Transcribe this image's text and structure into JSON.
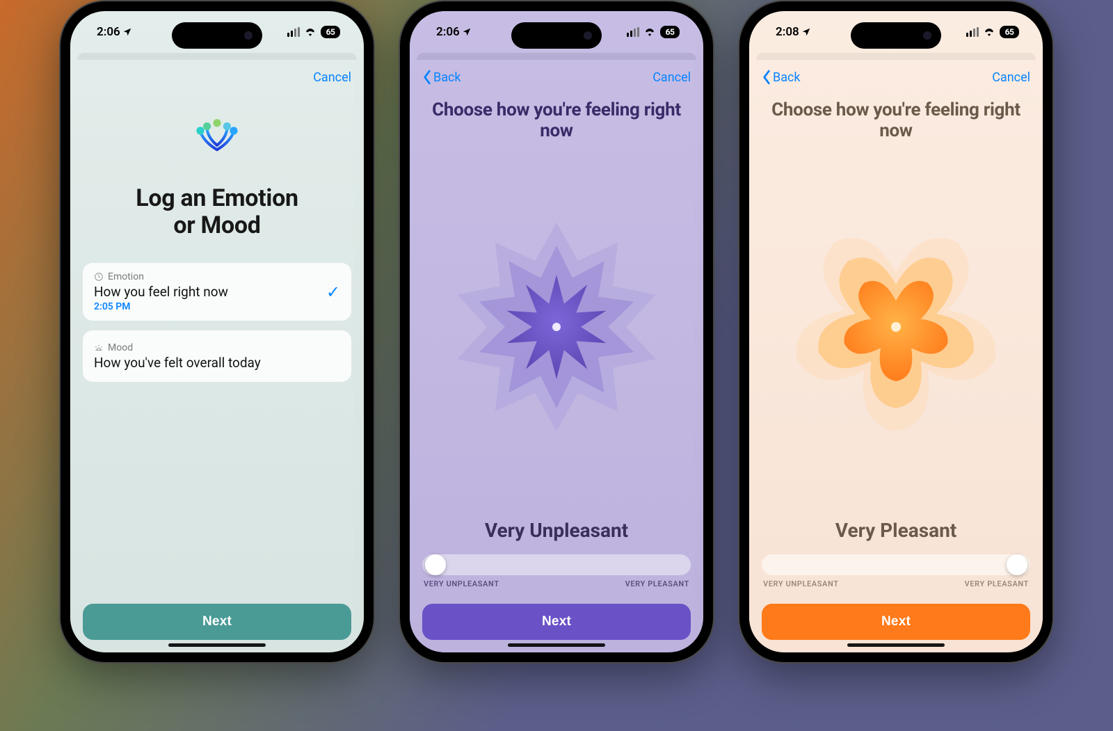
{
  "phones": [
    {
      "status": {
        "time": "2:06",
        "battery": "65"
      },
      "nav": {
        "back": "",
        "cancel": "Cancel"
      },
      "title": "Log an Emotion\nor Mood",
      "options": [
        {
          "eyebrow": "Emotion",
          "label": "How you feel right now",
          "time": "2:05 PM",
          "selected": true
        },
        {
          "eyebrow": "Mood",
          "label": "How you've felt overall today",
          "time": "",
          "selected": false
        }
      ],
      "cta": "Next"
    },
    {
      "status": {
        "time": "2:06",
        "battery": "65"
      },
      "nav": {
        "back": "Back",
        "cancel": "Cancel"
      },
      "title": "Choose how you're feeling right now",
      "mood_word": "Very Unpleasant",
      "slider": {
        "min_label": "VERY UNPLEASANT",
        "max_label": "VERY PLEASANT",
        "value_pct": 5
      },
      "cta": "Next"
    },
    {
      "status": {
        "time": "2:08",
        "battery": "65"
      },
      "nav": {
        "back": "Back",
        "cancel": "Cancel"
      },
      "title": "Choose how you're feeling right now",
      "mood_word": "Very Pleasant",
      "slider": {
        "min_label": "VERY UNPLEASANT",
        "max_label": "VERY PLEASANT",
        "value_pct": 95
      },
      "cta": "Next"
    }
  ]
}
